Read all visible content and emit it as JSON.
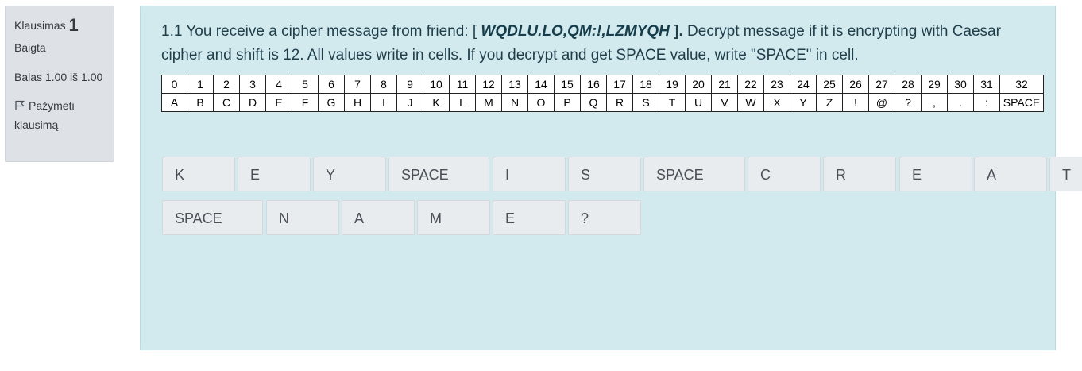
{
  "info": {
    "question_label": "Klausimas",
    "question_number": "1",
    "state": "Baigta",
    "grade": "Balas 1.00 iš 1.00",
    "flag_label": "Pažymėti klausimą"
  },
  "question": {
    "text_before": "1.1 You receive a cipher message from friend: [ ",
    "cipher_text": "WQDLU.LO,QM:!,LZMYQH",
    "bracket_close": " ].",
    "text_after": " Decrypt message if it is encrypting with Caesar cipher and shift is 12. All values write in cells. If you decrypt and get SPACE value, write \"SPACE\" in cell."
  },
  "cipher_table": {
    "numbers": [
      "0",
      "1",
      "2",
      "3",
      "4",
      "5",
      "6",
      "7",
      "8",
      "9",
      "10",
      "11",
      "12",
      "13",
      "14",
      "15",
      "16",
      "17",
      "18",
      "19",
      "20",
      "21",
      "22",
      "23",
      "24",
      "25",
      "26",
      "27",
      "28",
      "29",
      "30",
      "31",
      "32"
    ],
    "symbols": [
      "A",
      "B",
      "C",
      "D",
      "E",
      "F",
      "G",
      "H",
      "I",
      "J",
      "K",
      "L",
      "M",
      "N",
      "O",
      "P",
      "Q",
      "R",
      "S",
      "T",
      "U",
      "V",
      "W",
      "X",
      "Y",
      "Z",
      "!",
      "@",
      "?",
      ",",
      ".",
      ":",
      "SPACE"
    ]
  },
  "answers": {
    "row1": [
      "K",
      "E",
      "Y",
      "SPACE",
      "I",
      "S",
      "SPACE",
      "C",
      "R",
      "E",
      "A",
      "T"
    ],
    "row2": [
      "SPACE",
      "N",
      "A",
      "M",
      "E",
      "?"
    ]
  },
  "colors": {
    "formulation_bg": "#d2e9ee",
    "info_bg": "#dee2e6",
    "cell_bg": "#e9ecef"
  }
}
